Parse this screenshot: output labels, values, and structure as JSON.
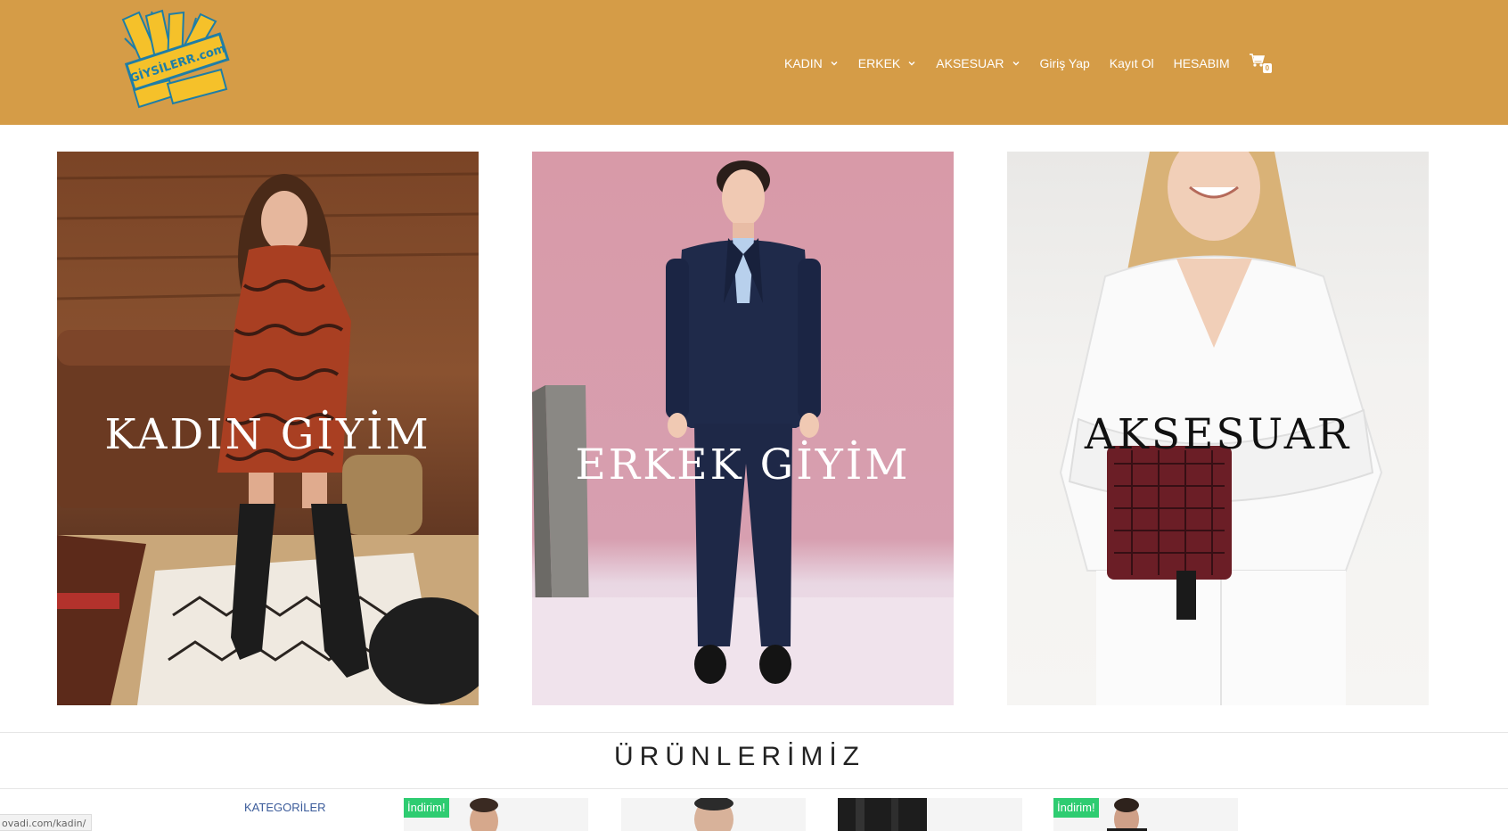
{
  "brand": {
    "logo_text": "GİYSİLERR.com",
    "header_color": "#d59c47",
    "logo_accent": "#f5c12a",
    "logo_blue": "#1f7ea6"
  },
  "nav": {
    "items": [
      {
        "label": "KADIN",
        "has_dropdown": true
      },
      {
        "label": "ERKEK",
        "has_dropdown": true
      },
      {
        "label": "AKSESUAR",
        "has_dropdown": true
      },
      {
        "label": "Giriş Yap",
        "has_dropdown": false
      },
      {
        "label": "Kayıt Ol",
        "has_dropdown": false
      },
      {
        "label": "HESABIM",
        "has_dropdown": false
      }
    ],
    "cart_icon": "cart-icon",
    "cart_count": "0"
  },
  "hero": {
    "cards": [
      {
        "title": "KADIN GİYİM"
      },
      {
        "title": "ERKEK GİYİM"
      },
      {
        "title": "AKSESUAR"
      }
    ]
  },
  "products_section": {
    "title": "ÜRÜNLERİMİZ",
    "categories_label": "KATEGORİLER",
    "products": [
      {
        "badge": "İndirim!"
      },
      {
        "badge": ""
      },
      {
        "badge": ""
      },
      {
        "badge": "İndirim!"
      }
    ],
    "badge_color": "#2ecc71"
  },
  "status_bar": {
    "url": "ovadi.com/kadin/"
  }
}
